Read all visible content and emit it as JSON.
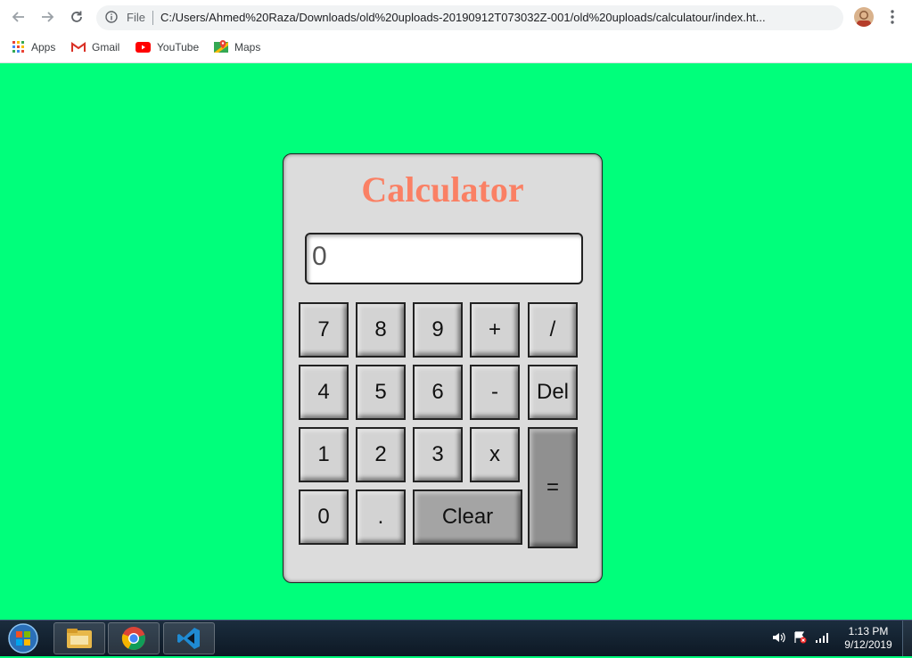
{
  "browser": {
    "url_scheme": "File",
    "url": "C:/Users/Ahmed%20Raza/Downloads/old%20uploads-20190912T073032Z-001/old%20uploads/calculatour/index.ht...",
    "bookmarks": [
      {
        "label": "Apps",
        "icon": "apps-grid-icon"
      },
      {
        "label": "Gmail",
        "icon": "gmail-icon"
      },
      {
        "label": "YouTube",
        "icon": "youtube-icon"
      },
      {
        "label": "Maps",
        "icon": "maps-icon"
      }
    ]
  },
  "calculator": {
    "title": "Calculator",
    "display_value": "0",
    "keys": {
      "k7": "7",
      "k8": "8",
      "k9": "9",
      "plus": "+",
      "divide": "/",
      "k4": "4",
      "k5": "5",
      "k6": "6",
      "minus": "-",
      "del": "Del",
      "k1": "1",
      "k2": "2",
      "k3": "3",
      "times": "x",
      "equals": "=",
      "k0": "0",
      "dot": ".",
      "clear": "Clear"
    }
  },
  "taskbar": {
    "apps": [
      "file-explorer-icon",
      "chrome-icon",
      "vscode-icon"
    ],
    "time": "1:13 PM",
    "date": "9/12/2019"
  },
  "colors": {
    "page_background": "#00ff7b",
    "title_color": "#fa8064",
    "calculator_body": "#dcdcdc"
  }
}
